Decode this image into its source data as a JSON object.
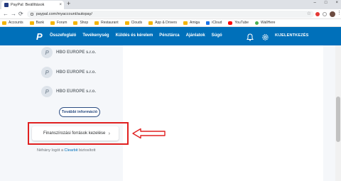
{
  "browser": {
    "tab_title": "PayPal: Beállítások",
    "tab_close": "×",
    "new_tab": "+",
    "window_controls": [
      "–",
      "□",
      "×"
    ],
    "back": "←",
    "forward": "→",
    "reload": "⟳",
    "url": "paypal.com/myaccount/autopay/",
    "star": "☆",
    "menu": "⋮"
  },
  "bookmarks": [
    {
      "label": "Accounts",
      "icon": "folder-icon"
    },
    {
      "label": "Bank",
      "icon": "folder-icon"
    },
    {
      "label": "Forum",
      "icon": "folder-icon"
    },
    {
      "label": "Shop",
      "icon": "folder-icon"
    },
    {
      "label": "Restaurant",
      "icon": "folder-icon"
    },
    {
      "label": "Clouds",
      "icon": "folder-icon"
    },
    {
      "label": "App & Drivers",
      "icon": "folder-icon"
    },
    {
      "label": "Amiga",
      "icon": "folder-icon"
    },
    {
      "label": "iCloud",
      "icon": "apple-icon"
    },
    {
      "label": "YouTube",
      "icon": "youtube-icon"
    },
    {
      "label": "WallHere",
      "icon": "wallhere-icon"
    }
  ],
  "header": {
    "logo": "P",
    "nav": [
      "Összefoglaló",
      "Tevékenység",
      "Küldés és kérelem",
      "Pénztárca",
      "Ajánlatok",
      "Súgó"
    ],
    "logout": "KIJELENTKEZÉS",
    "brand_color": "#0070ba"
  },
  "accounts": [
    {
      "name": "HBO EUROPE s.r.o."
    },
    {
      "name": "HBO EUROPE s.r.o."
    },
    {
      "name": "HBO EUROPE s.r.o."
    }
  ],
  "more_info_label": "További információ",
  "funding_button": {
    "label": "Finanszírozási források kezelése",
    "chevron": "›"
  },
  "footer": {
    "prefix": "Néhány logót a ",
    "link": "Clearbit",
    "suffix": " biztosított"
  },
  "annotation_color": "#e02020"
}
